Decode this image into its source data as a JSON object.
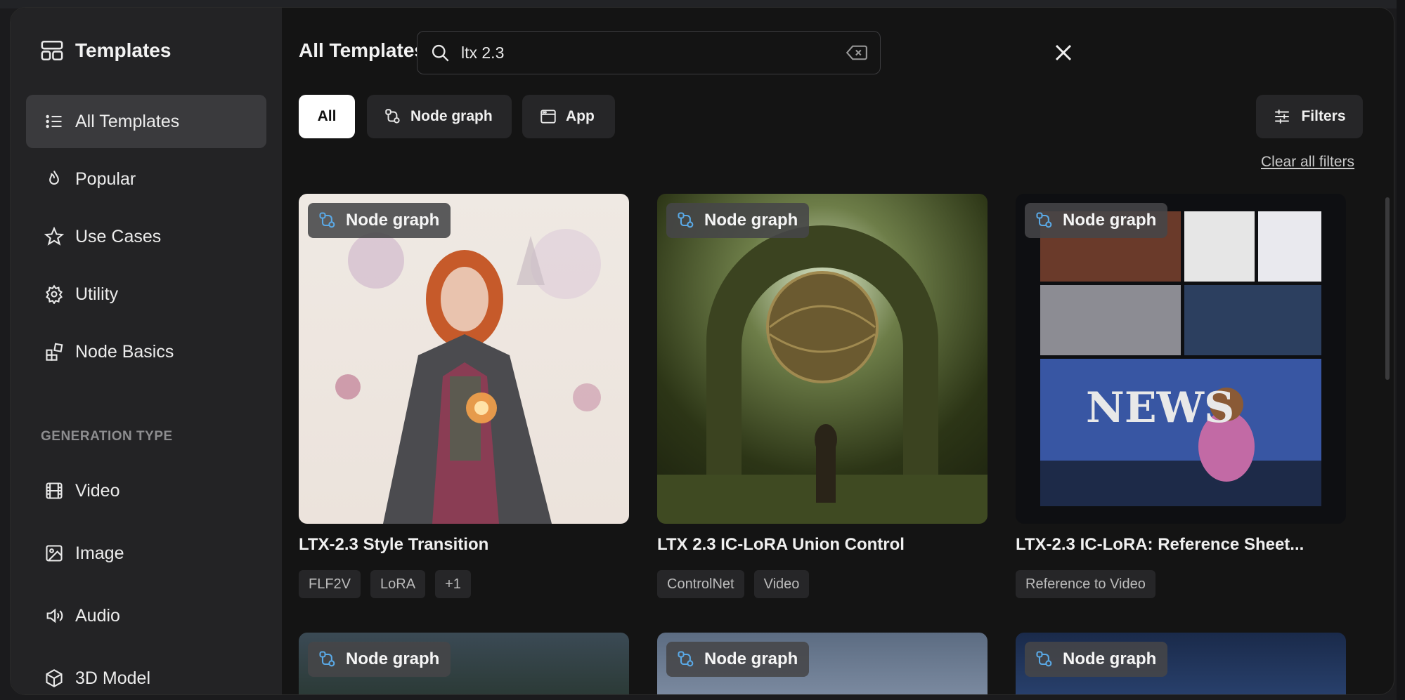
{
  "sidebar": {
    "title": "Templates",
    "items": [
      {
        "label": "All Templates",
        "icon": "list-icon"
      },
      {
        "label": "Popular",
        "icon": "flame-icon"
      },
      {
        "label": "Use Cases",
        "icon": "star-icon"
      },
      {
        "label": "Utility",
        "icon": "gear-icon"
      },
      {
        "label": "Node Basics",
        "icon": "blocks-icon"
      }
    ],
    "section_label": "GENERATION TYPE",
    "generation_types": [
      {
        "label": "Video",
        "icon": "film-icon"
      },
      {
        "label": "Image",
        "icon": "image-icon"
      },
      {
        "label": "Audio",
        "icon": "speaker-icon"
      },
      {
        "label": "3D Model",
        "icon": "cube-icon"
      }
    ]
  },
  "main": {
    "title": "All Templates",
    "search": {
      "value": "ltx 2.3",
      "placeholder": ""
    },
    "tabs": [
      {
        "label": "All"
      },
      {
        "label": "Node graph"
      },
      {
        "label": "App"
      }
    ],
    "filters_label": "Filters",
    "clear_filters": "Clear all filters",
    "cards": [
      {
        "badge": "Node graph",
        "title": "LTX-2.3 Style Transition",
        "tags": [
          "FLF2V",
          "LoRA",
          "+1"
        ]
      },
      {
        "badge": "Node graph",
        "title": "LTX 2.3 IC-LoRA Union Control",
        "tags": [
          "ControlNet",
          "Video"
        ]
      },
      {
        "badge": "Node graph",
        "title": "LTX-2.3 IC-LoRA: Reference Sheet...",
        "tags": [
          "Reference to Video"
        ]
      },
      {
        "badge": "Node graph"
      },
      {
        "badge": "Node graph"
      },
      {
        "badge": "Node graph"
      }
    ],
    "thumb3_text": "NEWS"
  },
  "colors": {
    "accent_icon": "#5aa9e6",
    "active_tab": "#ffffff",
    "panel": "#232325"
  }
}
